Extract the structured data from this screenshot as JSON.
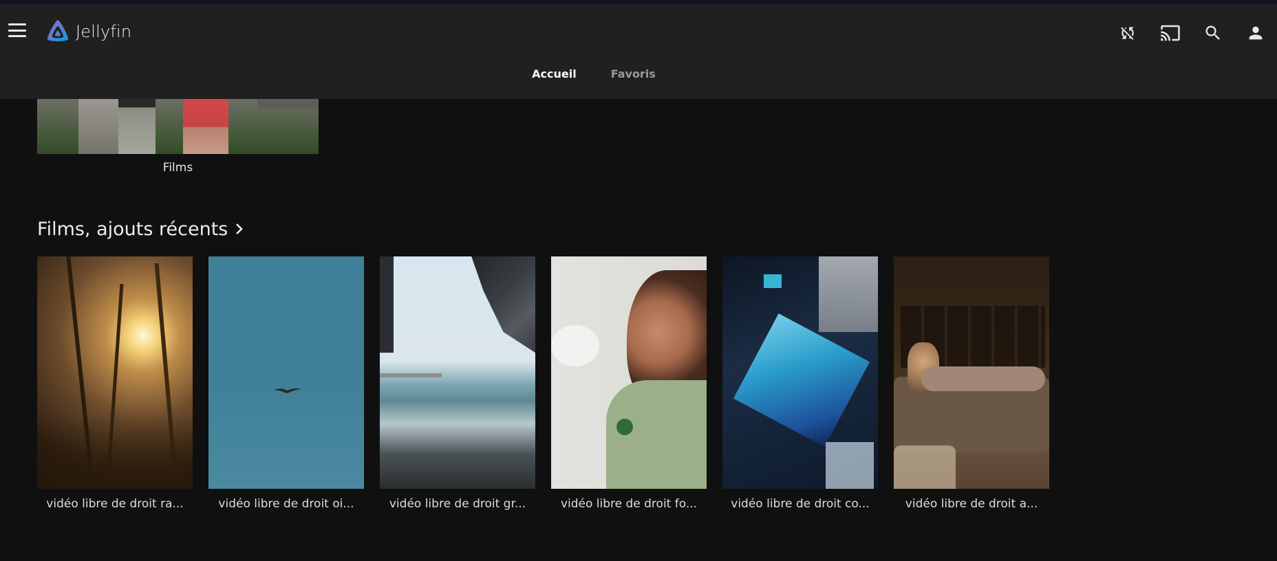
{
  "app": {
    "name": "Jellyfin"
  },
  "header": {
    "icons": [
      "sync-disabled-icon",
      "cast-icon",
      "search-icon",
      "user-icon"
    ]
  },
  "tabs": [
    {
      "label": "Accueil",
      "active": true
    },
    {
      "label": "Favoris",
      "active": false
    }
  ],
  "library": {
    "title": "Films"
  },
  "section": {
    "title": "Films, ajouts récents",
    "chevron": "chevron-right-icon"
  },
  "cards": [
    {
      "title": "vidéo libre de droit ra..."
    },
    {
      "title": "vidéo libre de droit oi..."
    },
    {
      "title": "vidéo libre de droit gr..."
    },
    {
      "title": "vidéo libre de droit fo..."
    },
    {
      "title": "vidéo libre de droit co..."
    },
    {
      "title": "vidéo libre de droit a..."
    }
  ],
  "colors": {
    "background": "#101010",
    "header": "#202020",
    "accent_logo": "#aa5cc3",
    "accent_logo_2": "#00a4dc"
  }
}
